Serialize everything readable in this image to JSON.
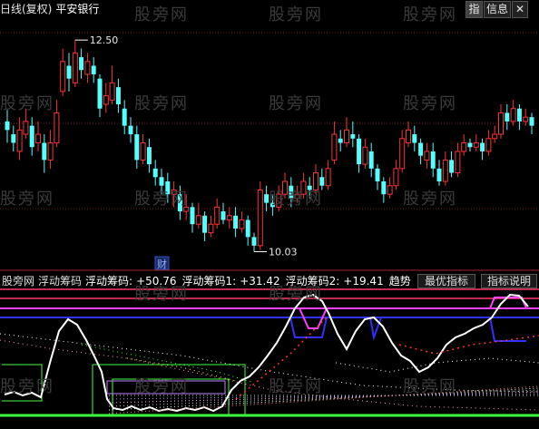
{
  "header": {
    "chart_type": "日线(复权)",
    "stock_name": "平安银行"
  },
  "toolbar": {
    "indicator_btn": "指",
    "info_btn": "信息",
    "close_btn": "✕"
  },
  "price_chart": {
    "high_label": "12.50",
    "low_label": "10.03",
    "event_badge": "财"
  },
  "indicator": {
    "source": "股旁网",
    "name": "浮动筹码",
    "v0_label": "浮动筹码:",
    "v0": "+50.76",
    "v1_label": "浮动筹码1:",
    "v1": "+31.42",
    "v2_label": "浮动筹码2:",
    "v2": "+19.41",
    "trend": "趋势",
    "best_btn": "最优指标",
    "help_btn": "指标说明"
  },
  "watermark": "股旁网",
  "colors": {
    "up": "#ff3232",
    "down": "#54ffff",
    "magenta": "#ff40ff",
    "blue": "#3030ff",
    "white": "#ffffff",
    "green": "#40ff40",
    "yellow": "#ffff40"
  },
  "candles": [
    [
      11.55,
      11.45,
      11.7,
      11.3
    ],
    [
      11.4,
      11.3,
      11.5,
      11.2
    ],
    [
      11.2,
      11.45,
      11.6,
      11.1
    ],
    [
      11.4,
      11.55,
      11.7,
      11.35
    ],
    [
      11.5,
      11.25,
      11.6,
      11.15
    ],
    [
      11.3,
      11.4,
      11.55,
      11.2
    ],
    [
      11.3,
      11.1,
      11.4,
      10.95
    ],
    [
      11.1,
      11.3,
      11.45,
      11.0
    ],
    [
      11.3,
      11.65,
      11.8,
      11.25
    ],
    [
      11.9,
      12.25,
      12.4,
      11.85
    ],
    [
      12.2,
      12.05,
      12.35,
      11.9
    ],
    [
      12.0,
      12.35,
      12.5,
      11.95
    ],
    [
      12.3,
      12.15,
      12.4,
      12.05
    ],
    [
      12.1,
      12.25,
      12.35,
      12.0
    ],
    [
      12.2,
      12.1,
      12.3,
      12.0
    ],
    [
      12.05,
      11.7,
      12.1,
      11.6
    ],
    [
      11.75,
      11.85,
      12.0,
      11.65
    ],
    [
      11.8,
      12.0,
      12.2,
      11.75
    ],
    [
      11.95,
      11.75,
      12.05,
      11.65
    ],
    [
      11.7,
      11.5,
      11.8,
      11.4
    ],
    [
      11.5,
      11.4,
      11.6,
      11.3
    ],
    [
      11.4,
      11.1,
      11.5,
      11.0
    ],
    [
      11.1,
      11.3,
      11.4,
      11.05
    ],
    [
      11.25,
      11.05,
      11.35,
      10.95
    ],
    [
      11.0,
      10.9,
      11.1,
      10.8
    ],
    [
      10.9,
      10.8,
      11.0,
      10.7
    ],
    [
      10.85,
      10.7,
      10.95,
      10.6
    ],
    [
      10.7,
      10.75,
      10.85,
      10.55
    ],
    [
      10.7,
      10.5,
      10.8,
      10.4
    ],
    [
      10.5,
      10.55,
      10.7,
      10.4
    ],
    [
      10.55,
      10.35,
      10.6,
      10.25
    ],
    [
      10.35,
      10.45,
      10.6,
      10.3
    ],
    [
      10.45,
      10.25,
      10.5,
      10.15
    ],
    [
      10.25,
      10.35,
      10.45,
      10.2
    ],
    [
      10.35,
      10.55,
      10.65,
      10.3
    ],
    [
      10.5,
      10.4,
      10.6,
      10.35
    ],
    [
      10.4,
      10.45,
      10.55,
      10.3
    ],
    [
      10.45,
      10.3,
      10.55,
      10.2
    ],
    [
      10.3,
      10.4,
      10.5,
      10.25
    ],
    [
      10.4,
      10.2,
      10.45,
      10.1
    ],
    [
      10.2,
      10.1,
      10.25,
      10.03
    ],
    [
      10.1,
      10.75,
      10.85,
      10.05
    ],
    [
      10.7,
      10.6,
      10.8,
      10.5
    ],
    [
      10.6,
      10.55,
      10.7,
      10.45
    ],
    [
      10.55,
      10.7,
      10.8,
      10.5
    ],
    [
      10.7,
      10.85,
      10.95,
      10.65
    ],
    [
      10.8,
      10.65,
      10.9,
      10.55
    ],
    [
      10.65,
      10.7,
      10.8,
      10.6
    ],
    [
      10.7,
      10.85,
      10.95,
      10.65
    ],
    [
      10.8,
      10.75,
      10.9,
      10.65
    ],
    [
      10.75,
      10.95,
      11.05,
      10.7
    ],
    [
      10.9,
      10.8,
      11.0,
      10.75
    ],
    [
      10.8,
      11.0,
      11.1,
      10.75
    ],
    [
      11.1,
      11.4,
      11.55,
      11.05
    ],
    [
      11.35,
      11.3,
      11.45,
      11.2
    ],
    [
      11.3,
      11.45,
      11.6,
      11.25
    ],
    [
      11.4,
      11.35,
      11.55,
      11.25
    ],
    [
      11.35,
      11.05,
      11.4,
      10.95
    ],
    [
      11.05,
      11.25,
      11.35,
      11.0
    ],
    [
      11.2,
      11.0,
      11.3,
      10.9
    ],
    [
      11.0,
      10.85,
      11.05,
      10.75
    ],
    [
      10.85,
      10.7,
      10.9,
      10.6
    ],
    [
      10.7,
      10.8,
      10.9,
      10.65
    ],
    [
      10.8,
      11.0,
      11.1,
      10.75
    ],
    [
      11.0,
      11.35,
      11.45,
      10.95
    ],
    [
      11.3,
      11.45,
      11.55,
      11.25
    ],
    [
      11.4,
      11.3,
      11.5,
      11.2
    ],
    [
      11.3,
      11.15,
      11.35,
      11.05
    ],
    [
      11.1,
      11.2,
      11.3,
      11.0
    ],
    [
      11.2,
      11.0,
      11.3,
      10.9
    ],
    [
      11.0,
      10.85,
      11.1,
      10.8
    ],
    [
      10.85,
      11.1,
      11.2,
      10.8
    ],
    [
      11.1,
      10.95,
      11.2,
      10.9
    ],
    [
      10.95,
      11.2,
      11.3,
      10.9
    ],
    [
      11.2,
      11.3,
      11.4,
      11.15
    ],
    [
      11.3,
      11.25,
      11.35,
      11.2
    ],
    [
      11.25,
      11.3,
      11.4,
      11.2
    ],
    [
      11.3,
      11.2,
      11.35,
      11.1
    ],
    [
      11.2,
      11.35,
      11.45,
      11.15
    ],
    [
      11.35,
      11.4,
      11.5,
      11.3
    ],
    [
      11.4,
      11.65,
      11.75,
      11.35
    ],
    [
      11.65,
      11.55,
      11.75,
      11.45
    ],
    [
      11.55,
      11.7,
      11.8,
      11.5
    ],
    [
      11.7,
      11.55,
      11.75,
      11.45
    ],
    [
      11.55,
      11.6,
      11.7,
      11.5
    ],
    [
      11.6,
      11.5,
      11.65,
      11.4
    ]
  ]
}
